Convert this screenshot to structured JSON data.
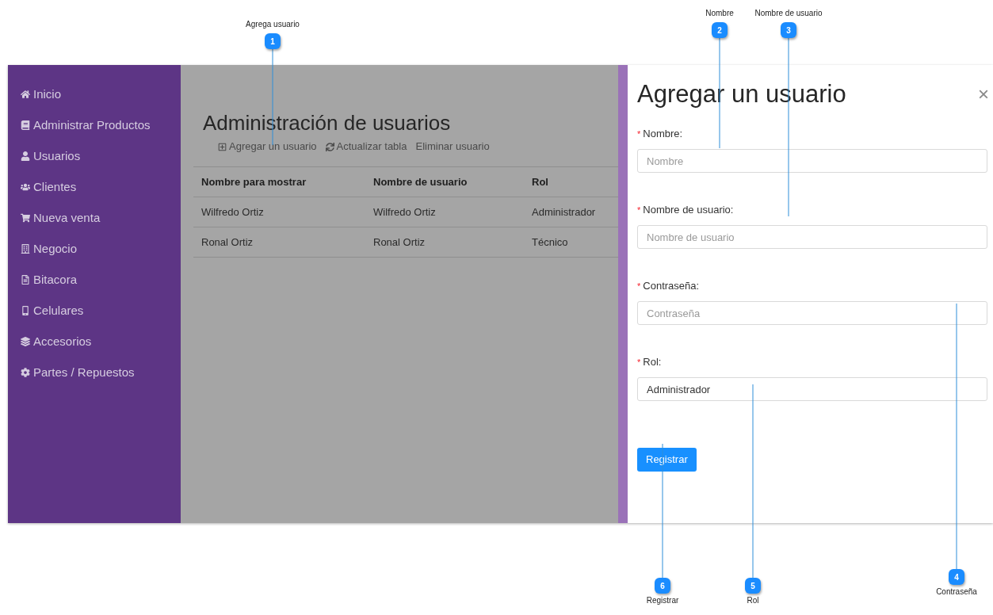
{
  "sidebar": {
    "items": [
      {
        "label": "Inicio"
      },
      {
        "label": "Administrar Productos"
      },
      {
        "label": "Usuarios"
      },
      {
        "label": "Clientes"
      },
      {
        "label": "Nueva venta"
      },
      {
        "label": "Negocio"
      },
      {
        "label": "Bitacora"
      },
      {
        "label": "Celulares"
      },
      {
        "label": "Accesorios"
      },
      {
        "label": "Partes / Repuestos"
      }
    ]
  },
  "page": {
    "title": "Administración de usuarios",
    "toolbar": [
      {
        "label": "Agregar un usuario",
        "kind": "add"
      },
      {
        "label": "Actualizar tabla",
        "kind": "refresh"
      },
      {
        "label": "Eliminar usuario",
        "kind": "plain"
      }
    ],
    "table": {
      "columns": [
        "Nombre para mostrar",
        "Nombre de usuario",
        "Rol"
      ],
      "rows": [
        [
          "Wilfredo Ortiz",
          "Wilfredo Ortiz",
          "Administrador"
        ],
        [
          "Ronal Ortiz",
          "Ronal Ortiz",
          "Técnico"
        ]
      ]
    }
  },
  "drawer": {
    "title": "Agregar un usuario",
    "close": "×",
    "fields": [
      {
        "label": "Nombre:",
        "required_mark": "*",
        "placeholder": "Nombre"
      },
      {
        "label": "Nombre de usuario:",
        "required_mark": "*",
        "placeholder": "Nombre de usuario"
      },
      {
        "label": "Contraseña:",
        "required_mark": "*",
        "placeholder": "Contraseña"
      },
      {
        "label": "Rol:",
        "required_mark": "*",
        "value": "Administrador"
      }
    ],
    "submit": "Registrar"
  },
  "callouts": [
    {
      "number": "1",
      "label": "Agrega usuario"
    },
    {
      "number": "2",
      "label": "Nombre"
    },
    {
      "number": "3",
      "label": "Nombre de usuario"
    },
    {
      "number": "4",
      "label": "Contraseña"
    },
    {
      "number": "5",
      "label": "Rol"
    },
    {
      "number": "6",
      "label": "Registrar"
    }
  ]
}
